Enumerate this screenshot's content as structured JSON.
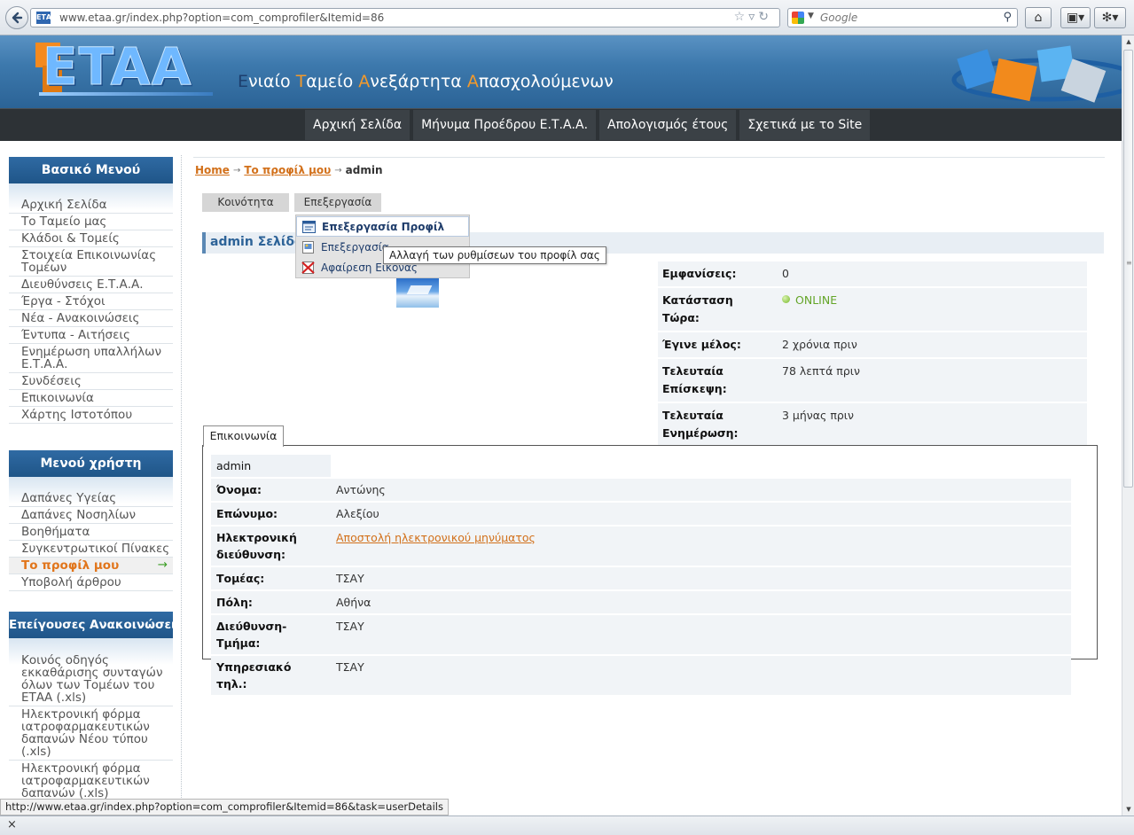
{
  "browser": {
    "url": "www.etaa.gr/index.php?option=com_comprofiler&Itemid=86",
    "favicon_text": "ΕΤΑΑ",
    "search_placeholder": "Google",
    "status_url": "http://www.etaa.gr/index.php?option=com_comprofiler&Itemid=86&task=userDetails",
    "statusbar_close": "×"
  },
  "header": {
    "logo_text": "ETAA",
    "tagline": [
      {
        "initial": "Ε",
        "rest": "νιαίο "
      },
      {
        "initial": "Τ",
        "rest": "αμείο "
      },
      {
        "initial": "Α",
        "rest": "νεξάρτητα "
      },
      {
        "initial": "Α",
        "rest": "πασχολούμενων"
      }
    ]
  },
  "nav": {
    "items": [
      "Αρχική Σελίδα",
      "Μήνυμα Προέδρου Ε.Τ.Α.Α.",
      "Απολογισμός έτους",
      "Σχετικά με το Site"
    ]
  },
  "sidebar": {
    "main_menu": {
      "title": "Βασικό Μενού",
      "items": [
        "Αρχική Σελίδα",
        "Το Ταμείο μας",
        "Κλάδοι & Τομείς",
        "Στοιχεία Επικοινωνίας Τομέων",
        "Διευθύνσεις Ε.Τ.Α.Α.",
        "Έργα - Στόχοι",
        "Νέα - Ανακοινώσεις",
        "Έντυπα - Αιτήσεις",
        "Ενημέρωση υπαλλήλων Ε.Τ.Α.Α.",
        "Συνδέσεις",
        "Επικοινωνία",
        "Χάρτης Ιστοτόπου"
      ]
    },
    "user_menu": {
      "title": "Μενού χρήστη",
      "items": [
        "Δαπάνες Υγείας",
        "Δαπάνες Νοσηλίων",
        "Βοηθήματα",
        "Συγκεντρωτικοί Πίνακες",
        "Το προφίλ μου",
        "Υποβολή άρθρου"
      ],
      "active_index": 4
    },
    "urgent": {
      "title": "Επείγουσες Ανακοινώσεις",
      "items": [
        "Κοινός οδηγός εκκαθάρισης συνταγών όλων των Τομέων του ΕΤΑΑ (.xls)",
        "Ηλεκτρονική φόρμα ιατροφαρμακευτικών δαπανών Νέου τύπου (.xls)",
        "Ηλεκτρονική φόρμα ιατροφαρμακευτικών δαπανών (.xls)"
      ]
    }
  },
  "breadcrumb": {
    "home": "Home",
    "profile": "Το προφίλ μου",
    "current": "admin",
    "separator": "→"
  },
  "profile_menu": {
    "community": "Κοινότητα",
    "edit": "Επεξεργασία",
    "dropdown": [
      "Επεξεργασία Προφίλ",
      "Επεξεργασία",
      "Αφαίρεση Εικόνας"
    ],
    "tooltip": "Αλλαγή των ρυθμίσεων του προφίλ σας"
  },
  "page_title": "admin Σελίδα",
  "stats": [
    {
      "label": "Εμφανίσεις:",
      "value": "0"
    },
    {
      "label": "Κατάσταση Τώρα:",
      "value": "ONLINE"
    },
    {
      "label": "Έγινε μέλος:",
      "value": "2 χρόνια πριν"
    },
    {
      "label": "Τελευταία Επίσκεψη:",
      "value": "78 λεπτά πριν"
    },
    {
      "label": "Τελευταία Ενημέρωση:",
      "value": "3 μήνας πριν"
    }
  ],
  "contact": {
    "tab_label": "Επικοινωνία",
    "username": "admin",
    "rows": [
      {
        "label": "Όνομα:",
        "value": "Αντώνης"
      },
      {
        "label": "Επώνυμο:",
        "value": "Αλεξίου"
      },
      {
        "label": "Ηλεκτρονική διεύθυνση:",
        "value": "Αποστολή ηλεκτρονικού μηνύματος"
      },
      {
        "label": "Τομέας:",
        "value": "ΤΣΑΥ"
      },
      {
        "label": "Πόλη:",
        "value": "Αθήνα"
      },
      {
        "label": "Διεύθυνση-Τμήμα:",
        "value": "ΤΣΑΥ"
      },
      {
        "label": "Υπηρεσιακό τηλ.:",
        "value": "ΤΣΑΥ"
      }
    ]
  },
  "colors": {
    "header_blue": "#3d79ad",
    "nav_dark": "#2d3236",
    "link_orange": "#d2701a",
    "online_green": "#64a528"
  }
}
